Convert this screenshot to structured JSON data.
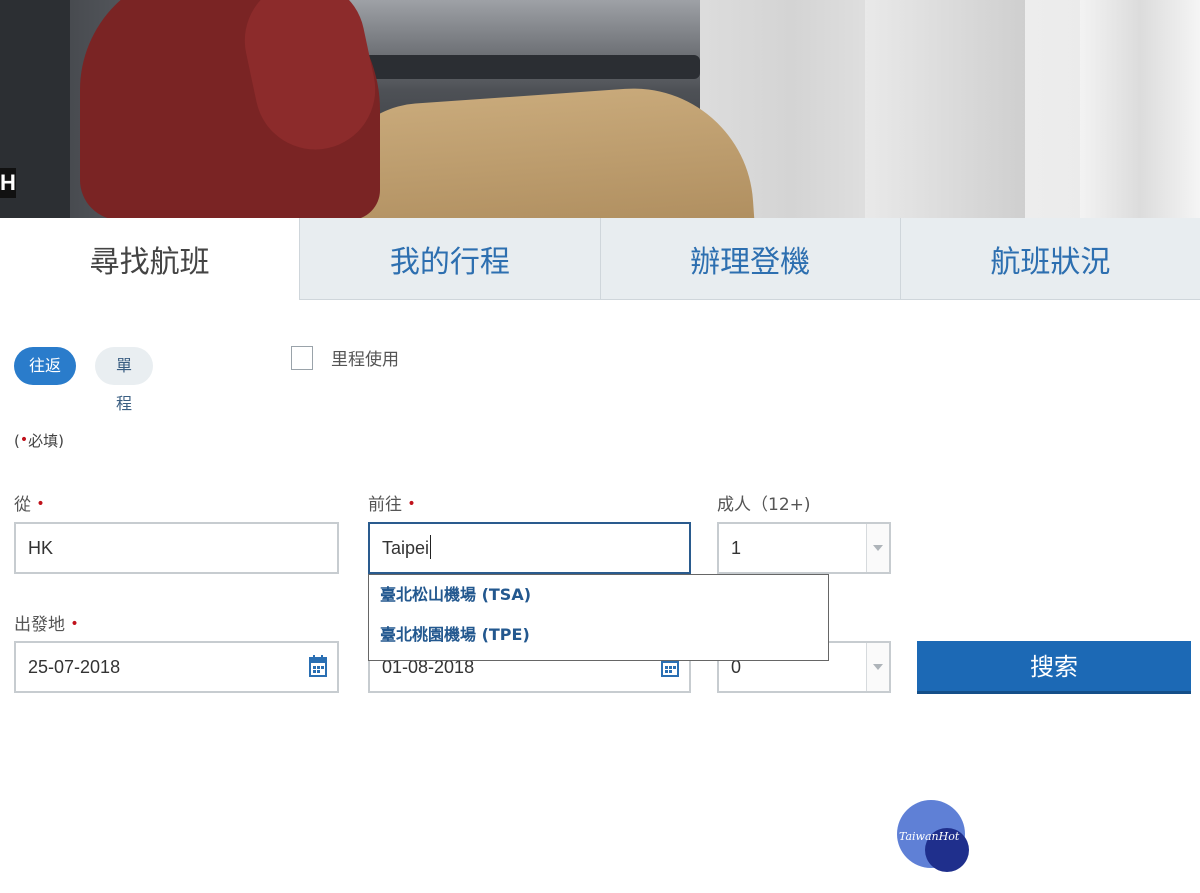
{
  "hero": {
    "edge_letter": "H"
  },
  "tabs": [
    {
      "label": "尋找航班"
    },
    {
      "label": "我的行程"
    },
    {
      "label": "辦理登機"
    },
    {
      "label": "航班狀況"
    }
  ],
  "trip_type": {
    "round_trip": "往返",
    "one_way": "單程"
  },
  "miles": {
    "label": "里程使用"
  },
  "required_note": {
    "prefix": "(",
    "dot": "•",
    "text": "必填)"
  },
  "from": {
    "label": "從",
    "value": "HK"
  },
  "to": {
    "label": "前往",
    "value": "Taipei"
  },
  "adults": {
    "label": "成人（12+)",
    "value": "1"
  },
  "depart": {
    "label": "出發地",
    "value": "25-07-2018"
  },
  "return_date": {
    "value": "01-08-2018"
  },
  "second_select": {
    "value": "0"
  },
  "suggestions": [
    {
      "label": "臺北松山機場 (TSA)"
    },
    {
      "label": "臺北桃園機場 (TPE)"
    }
  ],
  "search_button": {
    "label": "搜索"
  },
  "watermark": {
    "text": "TaiwanHot"
  },
  "colors": {
    "accent": "#1c69b5",
    "required": "#c0121b",
    "tab_inactive_bg": "#e8edf0"
  },
  "icons": {
    "calendar": "calendar-icon",
    "select": "chevron-down-icon"
  }
}
